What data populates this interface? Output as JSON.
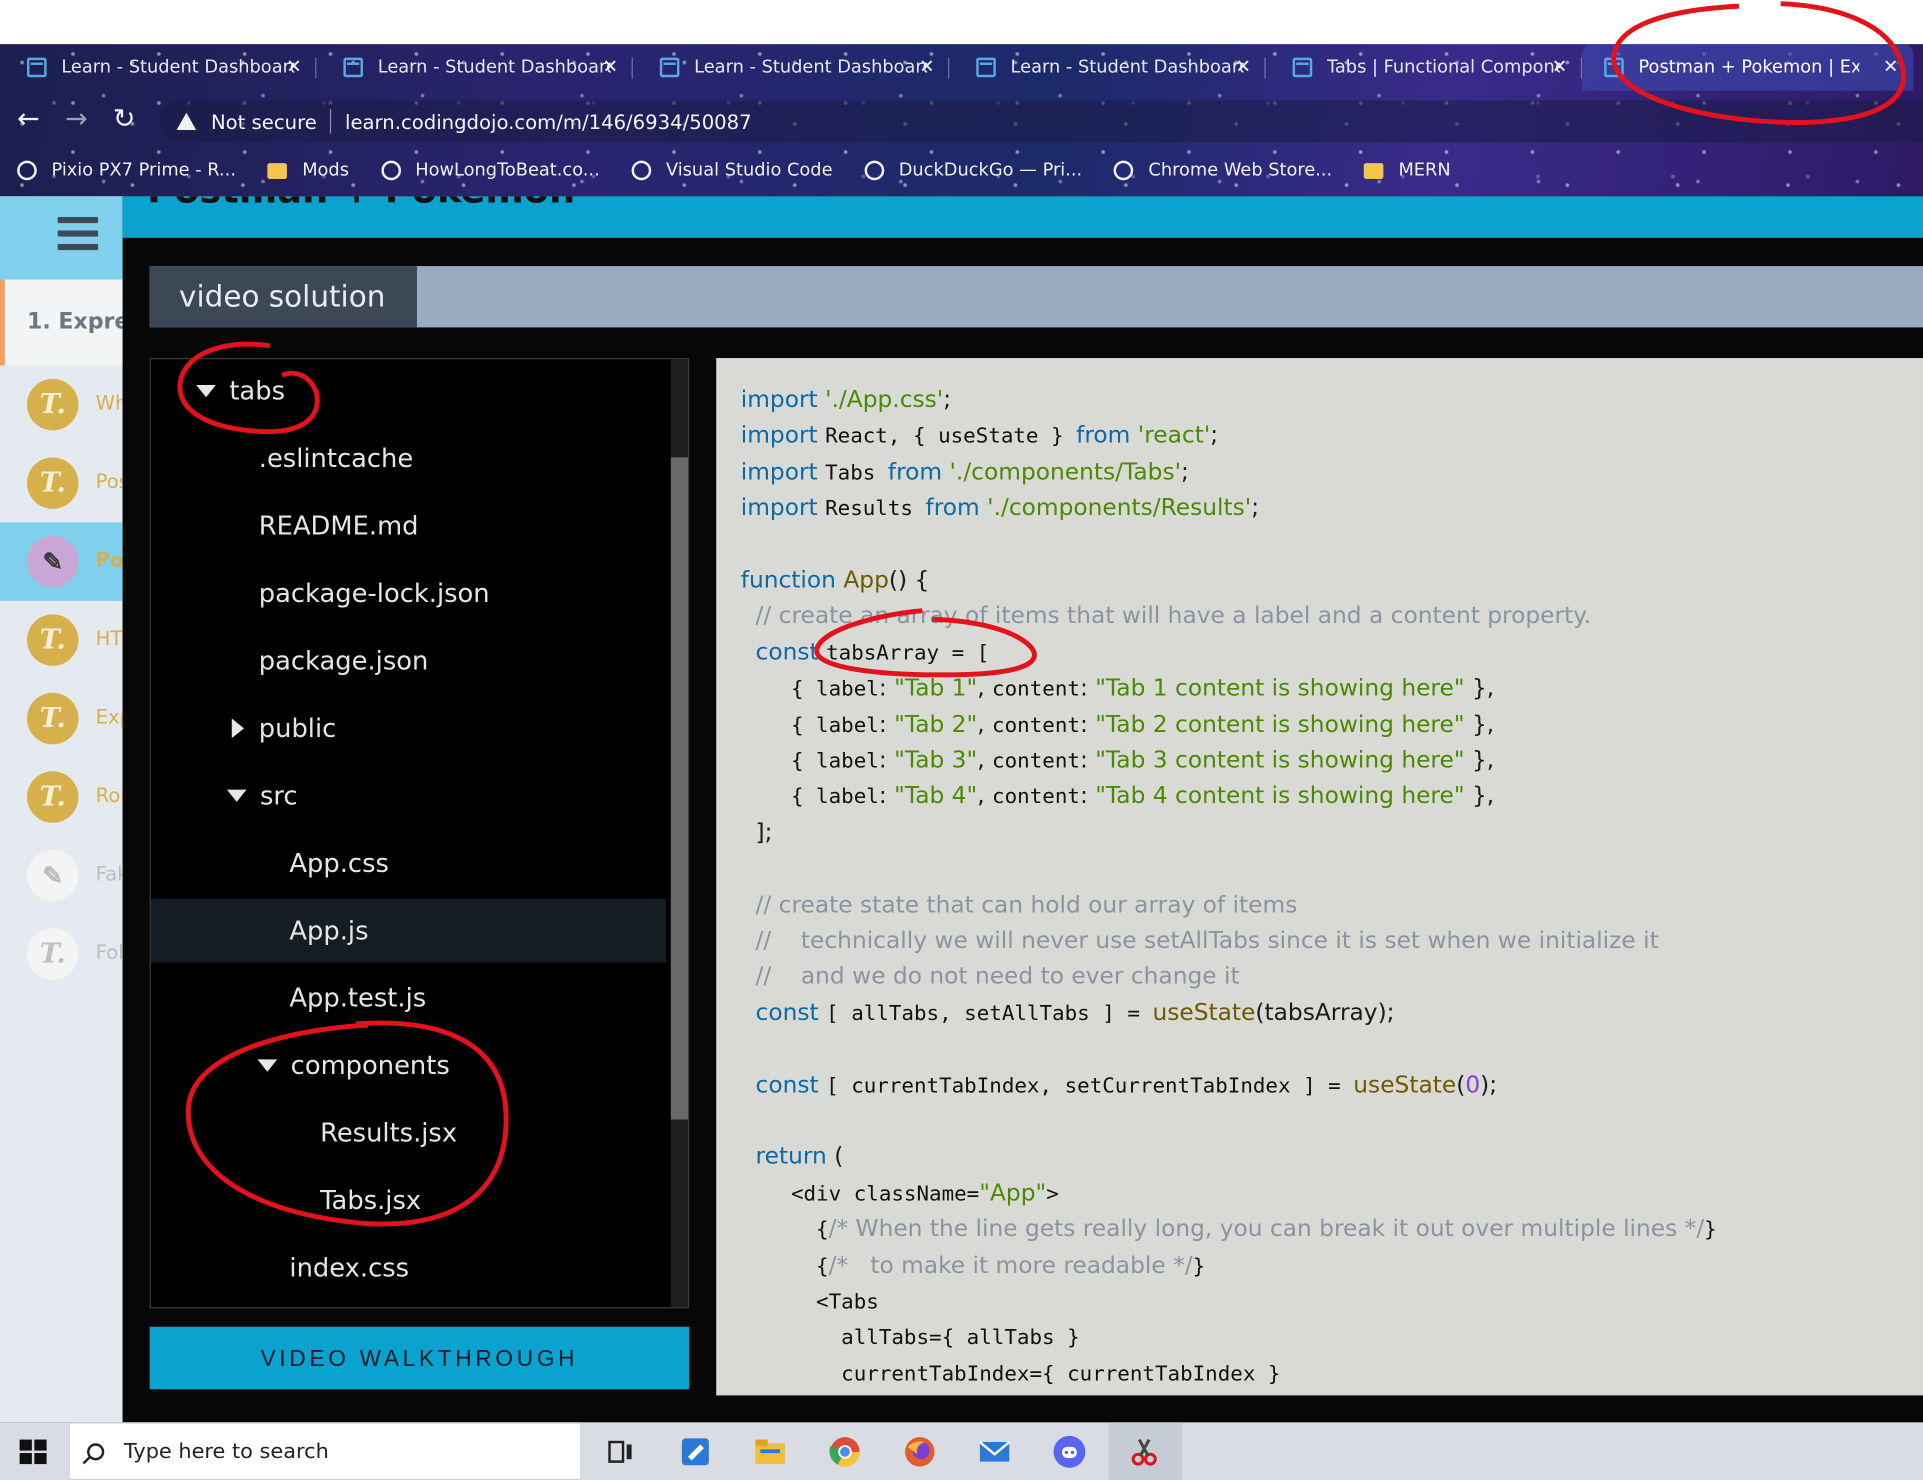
{
  "browser": {
    "tabs": [
      {
        "label": "Learn - Student Dashboard"
      },
      {
        "label": "Learn - Student Dashboard"
      },
      {
        "label": "Learn - Student Dashboard"
      },
      {
        "label": "Learn - Student Dashboard"
      },
      {
        "label": "Tabs | Functional Componer"
      },
      {
        "label": "Postman + Pokemon | Expre"
      }
    ],
    "close_glyph": "✕",
    "security_label": "Not secure",
    "url": "learn.codingdojo.com/m/146/6934/50087",
    "bookmarks": [
      {
        "label": "Pixio PX7 Prime - R...",
        "icon": "globe-icon"
      },
      {
        "label": "Mods",
        "icon": "folder-icon"
      },
      {
        "label": "HowLongToBeat.co...",
        "icon": "globe-icon"
      },
      {
        "label": "Visual Studio Code",
        "icon": "globe-icon"
      },
      {
        "label": "DuckDuckGo — Pri...",
        "icon": "globe-icon"
      },
      {
        "label": "Chrome Web Store...",
        "icon": "globe-icon"
      },
      {
        "label": "MERN",
        "icon": "folder-icon"
      }
    ]
  },
  "sidebar": {
    "section_label": "1. Expre",
    "lessons": [
      {
        "label": "Wh",
        "icon": "T."
      },
      {
        "label": "Pos",
        "icon": "T."
      },
      {
        "label": "Po",
        "icon": "✎"
      },
      {
        "label": "HT",
        "icon": "T."
      },
      {
        "label": "Exp",
        "icon": "T."
      },
      {
        "label": "Rou",
        "icon": "T."
      },
      {
        "label": "Fak",
        "icon": "✎"
      },
      {
        "label": "Fol",
        "icon": "T."
      }
    ]
  },
  "page": {
    "title": "Postman + Pokemon",
    "solution_tab": "video solution",
    "walkthrough_button": "VIDEO WALKTHROUGH"
  },
  "file_tree": [
    {
      "name": "tabs",
      "kind": "folder-open"
    },
    {
      "name": ".eslintcache",
      "kind": "file"
    },
    {
      "name": "README.md",
      "kind": "file"
    },
    {
      "name": "package-lock.json",
      "kind": "file"
    },
    {
      "name": "package.json",
      "kind": "file"
    },
    {
      "name": "public",
      "kind": "folder-closed"
    },
    {
      "name": "src",
      "kind": "folder-open"
    },
    {
      "name": "App.css",
      "kind": "file"
    },
    {
      "name": "App.js",
      "kind": "file",
      "selected": true
    },
    {
      "name": "App.test.js",
      "kind": "file"
    },
    {
      "name": "components",
      "kind": "folder-open"
    },
    {
      "name": "Results.jsx",
      "kind": "file"
    },
    {
      "name": "Tabs.jsx",
      "kind": "file"
    },
    {
      "name": "index.css",
      "kind": "file"
    }
  ],
  "code_lines": [
    [
      [
        "kw",
        "import "
      ],
      [
        "str",
        "'./App.css'"
      ],
      [
        "",
        "; "
      ]
    ],
    [
      [
        "kw",
        "import "
      ],
      [
        "mono",
        "React, { useState } "
      ],
      [
        "kw",
        "from "
      ],
      [
        "str",
        "'react'"
      ],
      [
        "",
        ";"
      ]
    ],
    [
      [
        "kw",
        "import "
      ],
      [
        "mono",
        "Tabs "
      ],
      [
        "kw",
        "from "
      ],
      [
        "str",
        "'./components/Tabs'"
      ],
      [
        "",
        ";"
      ]
    ],
    [
      [
        "kw",
        "import "
      ],
      [
        "mono",
        "Results "
      ],
      [
        "kw",
        "from "
      ],
      [
        "str",
        "'./components/Results'"
      ],
      [
        "",
        ";"
      ]
    ],
    [],
    [
      [
        "kw",
        "function "
      ],
      [
        "fn",
        "App"
      ],
      [
        "",
        "() {"
      ]
    ],
    [
      [
        "cm",
        "  // create an array of items that will have a label and a content property."
      ]
    ],
    [
      [
        "kw",
        "  const "
      ],
      [
        "mono",
        "tabsArray = ["
      ]
    ],
    [
      [
        "mono",
        "    { label"
      ],
      [
        "",
        ": "
      ],
      [
        "str",
        "\"Tab 1\""
      ],
      [
        "",
        ", "
      ],
      [
        "mono",
        "content"
      ],
      [
        "",
        ": "
      ],
      [
        "str",
        "\"Tab 1 content is showing here\""
      ],
      [
        "",
        " },"
      ]
    ],
    [
      [
        "mono",
        "    { label"
      ],
      [
        "",
        ": "
      ],
      [
        "str",
        "\"Tab 2\""
      ],
      [
        "",
        ", "
      ],
      [
        "mono",
        "content"
      ],
      [
        "",
        ": "
      ],
      [
        "str",
        "\"Tab 2 content is showing here\""
      ],
      [
        "",
        " },"
      ]
    ],
    [
      [
        "mono",
        "    { label"
      ],
      [
        "",
        ": "
      ],
      [
        "str",
        "\"Tab 3\""
      ],
      [
        "",
        ", "
      ],
      [
        "mono",
        "content"
      ],
      [
        "",
        ": "
      ],
      [
        "str",
        "\"Tab 3 content is showing here\""
      ],
      [
        "",
        " },"
      ]
    ],
    [
      [
        "mono",
        "    { label"
      ],
      [
        "",
        ": "
      ],
      [
        "str",
        "\"Tab 4\""
      ],
      [
        "",
        ", "
      ],
      [
        "mono",
        "content"
      ],
      [
        "",
        ": "
      ],
      [
        "str",
        "\"Tab 4 content is showing here\""
      ],
      [
        "",
        " },"
      ]
    ],
    [
      [
        "",
        "  ];"
      ]
    ],
    [],
    [
      [
        "cm",
        "  // create state that can hold our array of items"
      ]
    ],
    [
      [
        "cm",
        "  //    technically we will never use setAllTabs since it is set when we initialize it"
      ]
    ],
    [
      [
        "cm",
        "  //    and we do not need to ever change it"
      ]
    ],
    [
      [
        "kw",
        "  const "
      ],
      [
        "mono",
        "[ allTabs, setAllTabs ] = "
      ],
      [
        "fn",
        "useState"
      ],
      [
        "",
        "(tabsArray);"
      ]
    ],
    [],
    [
      [
        "kw",
        "  const "
      ],
      [
        "mono",
        "[ currentTabIndex, setCurrentTabIndex ] = "
      ],
      [
        "fn",
        "useState"
      ],
      [
        "",
        "("
      ],
      [
        "num",
        "0"
      ],
      [
        "",
        ");"
      ]
    ],
    [],
    [
      [
        "kw",
        "  return "
      ],
      [
        "",
        "("
      ]
    ],
    [
      [
        "mono",
        "    <div className="
      ],
      [
        "str",
        "\"App\""
      ],
      [
        "mono",
        ">"
      ]
    ],
    [
      [
        "mono",
        "      {"
      ],
      [
        "cm",
        "/* When the line gets really long, you can break it out over multiple lines */"
      ],
      [
        "mono",
        "}"
      ]
    ],
    [
      [
        "mono",
        "      {"
      ],
      [
        "cm",
        "/*   to make it more readable */"
      ],
      [
        "mono",
        "}"
      ]
    ],
    [
      [
        "mono",
        "      <Tabs"
      ]
    ],
    [
      [
        "mono",
        "        allTabs={ allTabs }"
      ]
    ],
    [
      [
        "mono",
        "        currentTabIndex={ currentTabIndex }"
      ]
    ]
  ],
  "taskbar": {
    "search_placeholder": "Type here to search",
    "apps": [
      "task-view-icon",
      "sticky-notes-icon",
      "file-explorer-icon",
      "chrome-icon",
      "firefox-icon",
      "mail-icon",
      "discord-icon",
      "snipping-tool-icon"
    ]
  },
  "colors": {
    "accent": "#0aa3cf",
    "annotation": "#e3121b",
    "code_keyword": "#0b6aa6",
    "code_string": "#4a8a00",
    "code_comment": "#8a94a0"
  }
}
